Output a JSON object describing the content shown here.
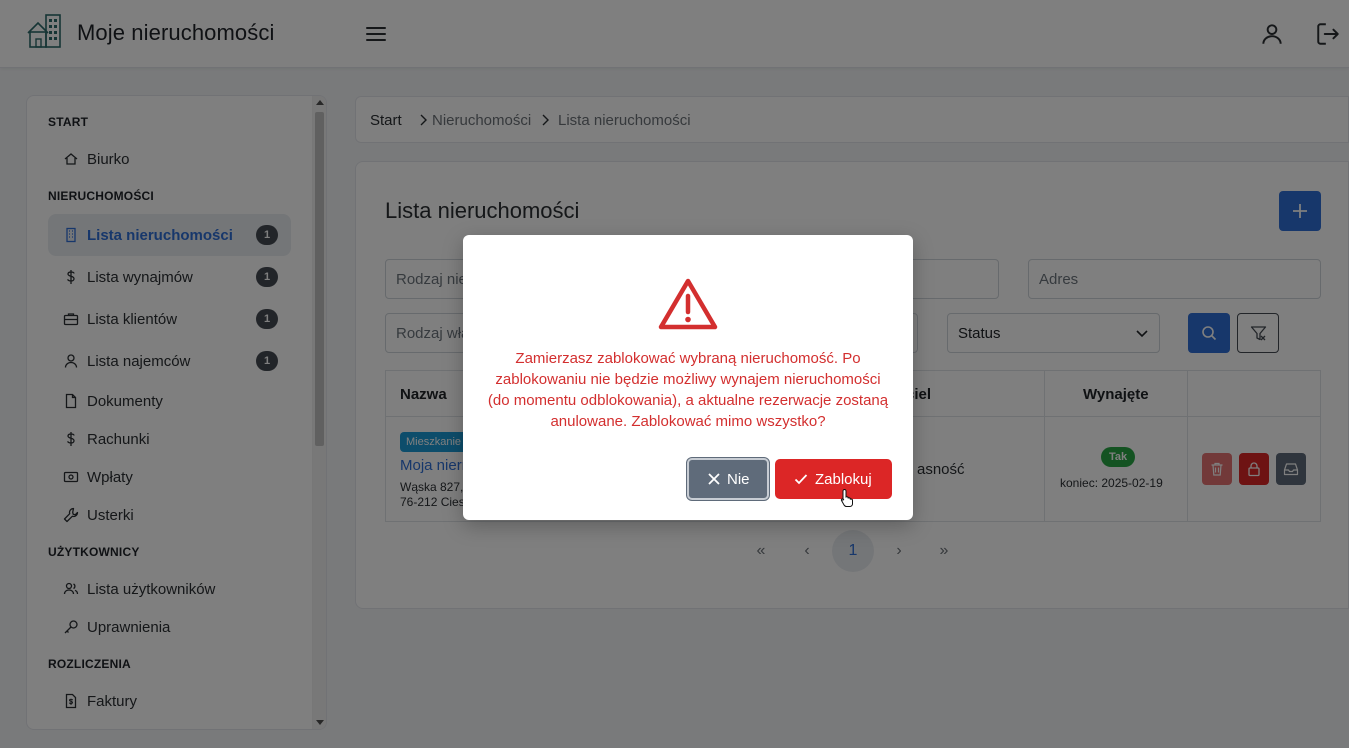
{
  "header": {
    "app_title": "Moje nieruchomości",
    "logo_icon": "house-building-icon",
    "menu_icon": "hamburger-icon",
    "user_icon": "user-icon",
    "logout_icon": "logout-icon"
  },
  "sidebar": {
    "sections": [
      {
        "title": "START",
        "items": [
          {
            "label": "Biurko",
            "icon": "home-icon"
          }
        ]
      },
      {
        "title": "NIERUCHOMOŚCI",
        "items": [
          {
            "label": "Lista nieruchomości",
            "icon": "building-icon",
            "badge": "1",
            "active": true
          },
          {
            "label": "Lista wynajmów",
            "icon": "dollar-icon",
            "badge": "1"
          },
          {
            "label": "Lista klientów",
            "icon": "briefcase-icon",
            "badge": "1"
          },
          {
            "label": "Lista najemców",
            "icon": "user-icon",
            "badge": "1"
          },
          {
            "label": "Dokumenty",
            "icon": "document-icon"
          },
          {
            "label": "Rachunki",
            "icon": "dollar-icon"
          },
          {
            "label": "Wpłaty",
            "icon": "cash-icon"
          },
          {
            "label": "Usterki",
            "icon": "wrench-icon"
          }
        ]
      },
      {
        "title": "UŻYTKOWNICY",
        "items": [
          {
            "label": "Lista użytkowników",
            "icon": "users-icon"
          },
          {
            "label": "Uprawnienia",
            "icon": "key-icon"
          }
        ]
      },
      {
        "title": "ROZLICZENIA",
        "items": [
          {
            "label": "Faktury",
            "icon": "invoice-icon"
          }
        ]
      }
    ]
  },
  "breadcrumb": {
    "start": "Start",
    "middle": "Nieruchomości",
    "current": "Lista nieruchomości"
  },
  "main": {
    "title": "Lista nieruchomości",
    "filters": {
      "type_placeholder": "Rodzaj nie",
      "address_placeholder": "Adres",
      "ownership_placeholder": "Rodzaj wła",
      "status_value": "Status"
    },
    "table": {
      "headers": {
        "name": "Nazwa",
        "owner": "ciel",
        "rented": "Wynajęte"
      },
      "row": {
        "type": "Mieszkanie",
        "name": "Moja niern",
        "address_line1": "Wąska 827,",
        "address_line2": "76-212 Cies",
        "owner": "asność",
        "rented_badge": "Tak",
        "rented_end": "koniec: 2025-02-19"
      }
    },
    "pagination": {
      "first": "«",
      "prev": "‹",
      "current": "1",
      "next": "›",
      "last": "»"
    }
  },
  "modal": {
    "icon": "warning-triangle-icon",
    "message": "Zamierzasz zablokować wybraną nieruchomość. Po zablokowaniu nie będzie możliwy wynajem nieruchomości (do momentu odblokowania), a aktualne rezerwacje zostaną anulowane. Zablokować mimo wszystko?",
    "cancel_label": "Nie",
    "confirm_label": "Zablokuj"
  },
  "colors": {
    "primary": "#2f6fd6",
    "danger": "#dc2626",
    "secondary": "#5f6b7a",
    "success": "#28a745",
    "info": "#1b9bd7"
  }
}
